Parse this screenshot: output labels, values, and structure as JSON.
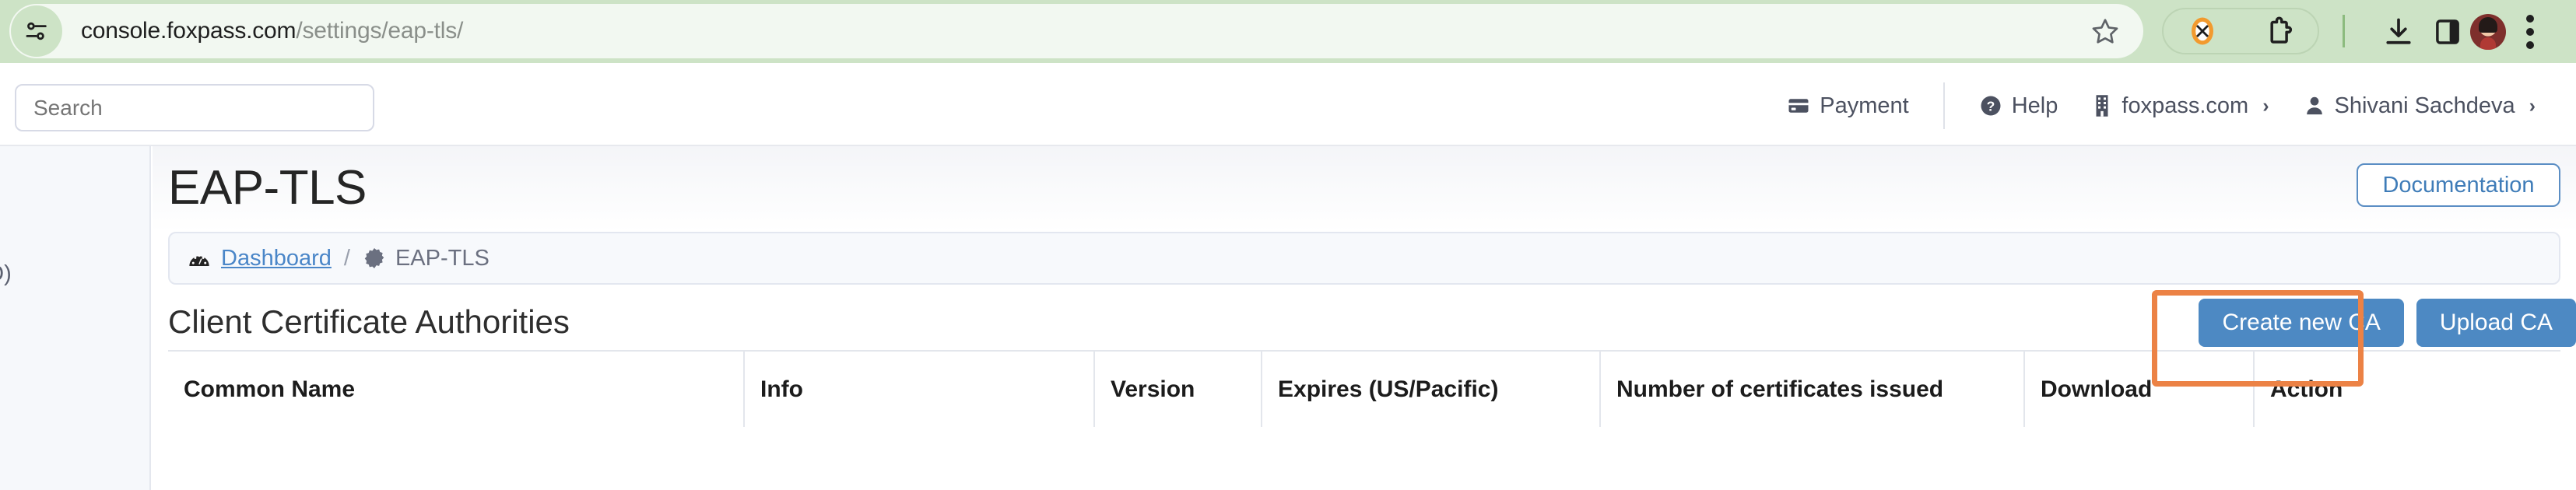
{
  "browser": {
    "url_domain": "console.foxpass.com",
    "url_path": "/settings/eap-tls/",
    "icons": {
      "site_settings": "tune-sliders-icon",
      "bookmark": "star-outline-icon",
      "extension_orange": "extension-blocked-icon",
      "extensions": "puzzle-piece-icon",
      "downloads": "download-icon",
      "side_panel": "side-panel-icon",
      "profile": "avatar-icon",
      "menu": "kebab-menu-icon"
    },
    "toolbar_bg": "#cde3c6",
    "omnibox_bg": "#f2f8f1"
  },
  "app_header": {
    "search_placeholder": "Search",
    "search_value": "",
    "payment_label": "Payment",
    "help_label": "Help",
    "org_label": "foxpass.com",
    "org_chevron": "›",
    "user_label": "Shivani Sachdeva",
    "user_chevron": "›"
  },
  "sidebar": {
    "visible_item_label": "n (SSO)"
  },
  "page": {
    "title": "EAP-TLS",
    "documentation_label": "Documentation",
    "breadcrumb": {
      "home_label": "Dashboard",
      "separator": "/",
      "current_label": "EAP-TLS"
    },
    "section_title": "Client Certificate Authorities",
    "create_ca_label": "Create new CA",
    "upload_ca_label": "Upload CA"
  },
  "table": {
    "columns": [
      "Common Name",
      "Info",
      "Version",
      "Expires (US/Pacific)",
      "Number of certificates issued",
      "Download",
      "Action"
    ],
    "rows": []
  },
  "colors": {
    "primary_button": "#4d89c3",
    "link": "#4a86c8",
    "highlight_box": "#ec8245",
    "browser_green": "#cde3c6",
    "sidebar_bg": "#f6f8fb"
  }
}
